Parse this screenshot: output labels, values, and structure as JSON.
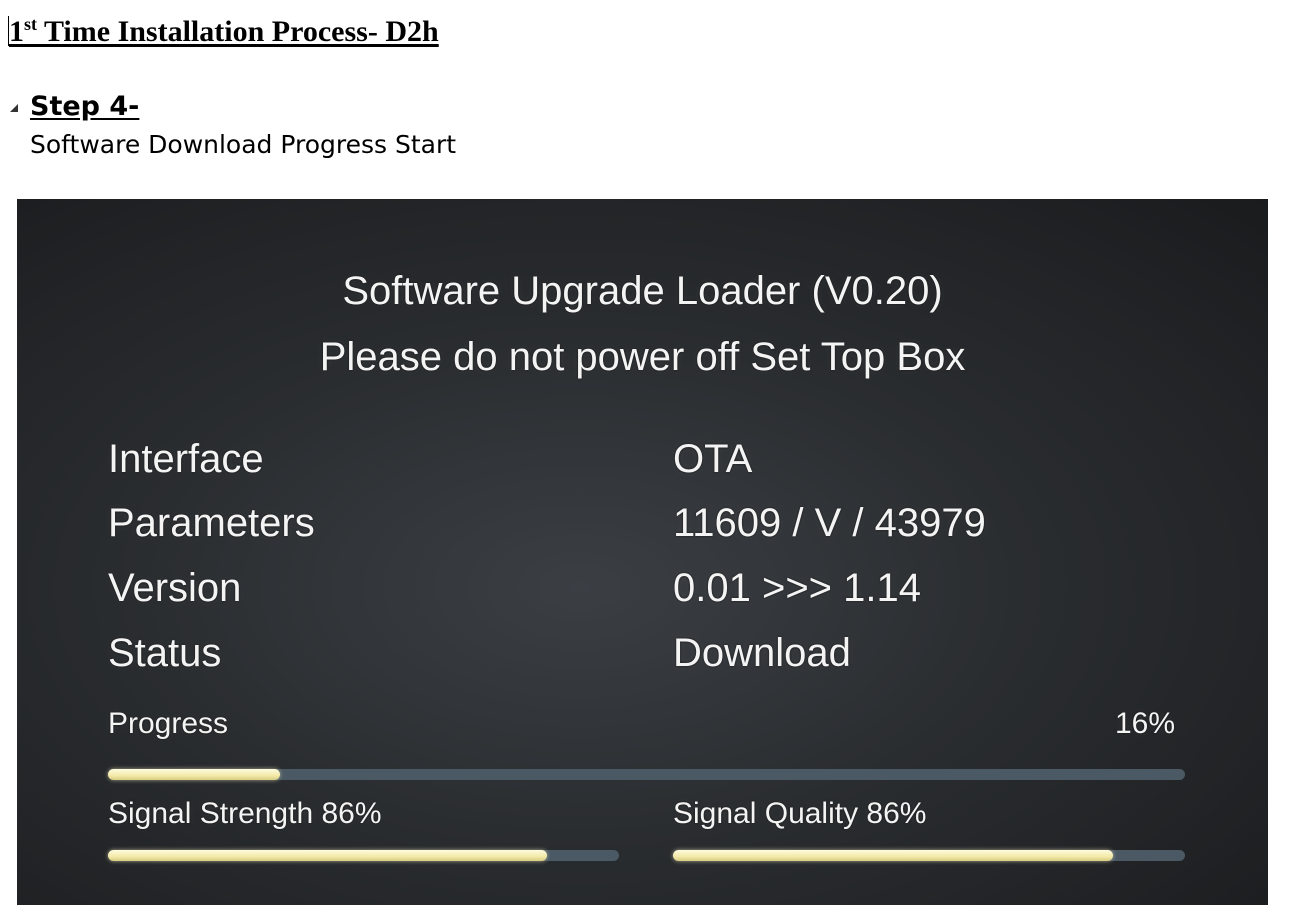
{
  "document": {
    "title_prefix": "1",
    "title_sup": "st",
    "title_rest": " Time Installation Process- D2h",
    "step_heading": "Step 4-",
    "step_description": "Software Download Progress Start"
  },
  "screen": {
    "heading": "Software Upgrade Loader (V0.20)",
    "warning": "Please do not power off Set Top Box",
    "rows": [
      {
        "label": "Interface",
        "value": "OTA"
      },
      {
        "label": "Parameters",
        "value": "11609 / V / 43979"
      },
      {
        "label": "Version",
        "value": "0.01 >>> 1.14"
      },
      {
        "label": "Status",
        "value": "Download"
      }
    ],
    "progress": {
      "label": "Progress",
      "text": "16%",
      "fraction": 0.16
    },
    "signal_strength": {
      "label": "Signal Strength  86%",
      "fraction": 0.86
    },
    "signal_quality": {
      "label": "Signal Quality 86%",
      "fraction": 0.86
    }
  },
  "colors": {
    "screen_bg": "#2a2d30",
    "bar_track": "#4a5964",
    "bar_fill": "#f3e9a8",
    "screen_text": "#f4f4f4"
  }
}
